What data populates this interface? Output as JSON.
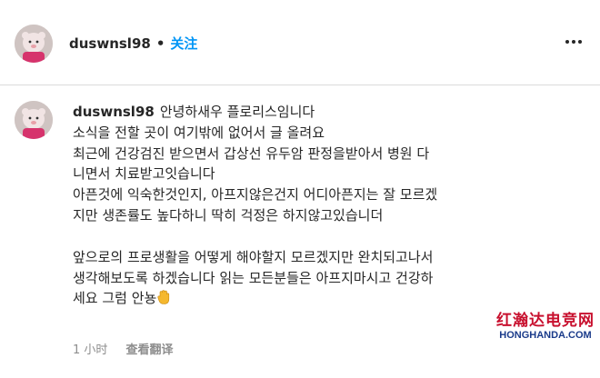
{
  "post_header": {
    "username": "duswnsl98",
    "separator": "•",
    "follow_label": "关注",
    "more_icon": "more-horizontal-icon"
  },
  "comment": {
    "username": "duswnsl98",
    "lines": [
      "안녕하새우 플로리스임니다",
      "소식을 전할 곳이 여기밖에 없어서 글 올려요",
      "최근에 건강검진 받으면서 갑상선 유두암 판정을받아서 병원 다",
      "니면서 치료받고잇습니다",
      "아픈것에 익숙한것인지, 아프지않은건지 어디아픈지는 잘 모르겠",
      "지만 생존률도 높다하니 딱히 걱정은 하지않고있습니더",
      "",
      "앞으로의 프로생활을 어떻게 해야할지 모르겠지만 완치되고나서",
      "생각해보도록 하겠습니다 읽는 모든분들은 아프지마시고 건강하",
      "세요 그럼 안뇽"
    ],
    "emoji": "waving-hand-icon",
    "time": "1 小时",
    "translate_label": "查看翻译"
  },
  "watermark": {
    "top": "红瀚达电竞网",
    "bottom": "HONGHANDA.COM"
  }
}
